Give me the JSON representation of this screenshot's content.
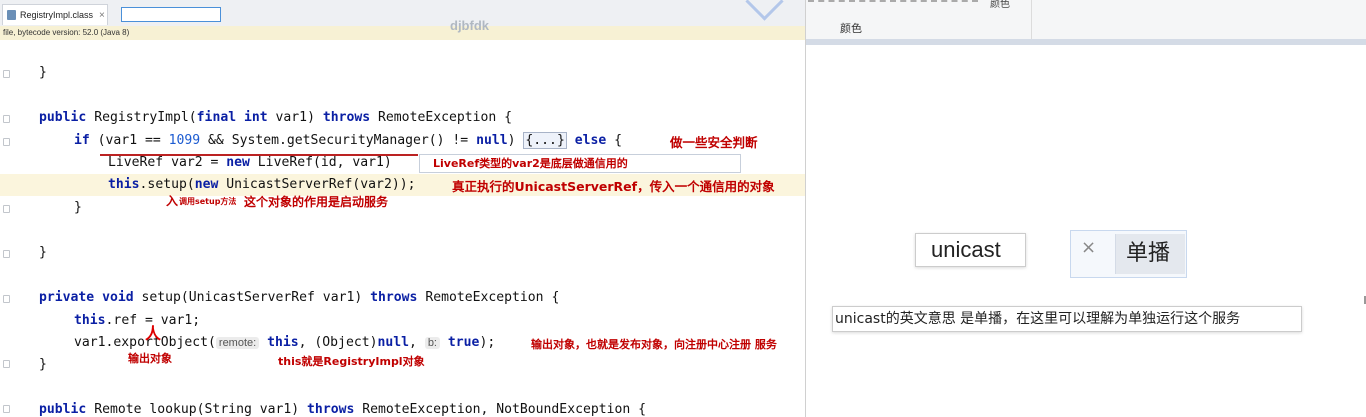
{
  "editor": {
    "tab_label": "RegistryImpl.class",
    "tab_close": "×",
    "info_text": "file, bytecode version: 52.0 (Java 8)",
    "watermark": "djbfdk",
    "lines": {
      "l1": "}",
      "l2_a": "public ",
      "l2_b": "RegistryImpl(",
      "l2_c": "final ",
      "l2_d": "int ",
      "l2_e": "var1) ",
      "l2_f": "throws ",
      "l2_g": "RemoteException {",
      "l3_a": "if ",
      "l3_b": "(var1 == ",
      "l3_c": "1099",
      "l3_d": " && System.getSecurityManager() != ",
      "l3_e": "null",
      "l3_f": ") ",
      "l3_g": "{...}",
      "l3_h": " else ",
      "l3_i": "{",
      "l4_a": "LiveRef var2 = ",
      "l4_b": "new ",
      "l4_c": "LiveRef(id, var1)",
      "l5_a": "this",
      "l5_b": ".setup(",
      "l5_c": "new ",
      "l5_d": "UnicastServerRef(var2));",
      "l6": "}",
      "l7": "}",
      "l8_a": "private ",
      "l8_b": "void ",
      "l8_c": "setup(UnicastServerRef var1) ",
      "l8_d": "throws ",
      "l8_e": "RemoteException {",
      "l9_a": "this",
      "l9_b": ".ref = var1;",
      "l10_a": "var1.exportObject(",
      "l10_b": "remote:",
      "l10_c": "this",
      "l10_d": ", (Object)",
      "l10_e": "null",
      "l10_f": ", ",
      "l10_g": "b:",
      "l10_h": "true",
      "l10_i": ");",
      "l11": "}",
      "l12_a": "public ",
      "l12_b": "Remote lookup(String var1) ",
      "l12_c": "throws ",
      "l12_d": "RemoteException, NotBoundException {"
    },
    "annotations": {
      "security": "做一些安全判断",
      "liveref": "LiveRef类型的var2是底层做通信用的",
      "unicast": "真正执行的UnicastServerRef，传入一个通信用的对象",
      "call_setup_small": "调用setup方法",
      "start_service": "这个对象的作用是启动服务",
      "output_obj": "输出对象",
      "publish": "输出对象，也就是发布对象，向注册中心注册 服务",
      "this_is": "this就是RegistryImpl对象"
    }
  },
  "translator": {
    "toolbar_top_label": "颜色",
    "color_label": "颜色",
    "source_word": "unicast",
    "clear_icon": "×",
    "result_word": "单播",
    "note": "unicast的英文意思 是单播，在这里可以理解为单独运行这个服务"
  },
  "colors": {
    "keyword": "#0a1fa4",
    "number": "#1c5bd1",
    "annotation": "#c00000",
    "highlight_line": "#fbf5dd"
  }
}
